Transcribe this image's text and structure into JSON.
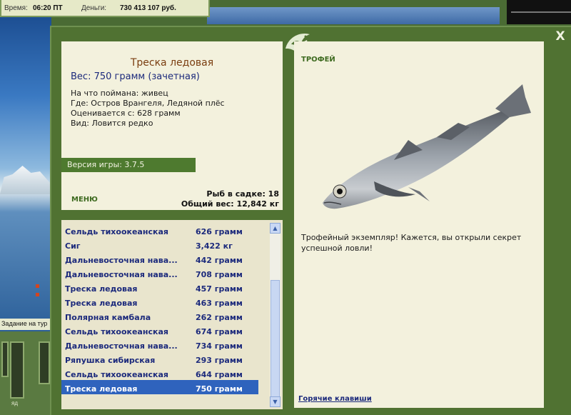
{
  "status_bar": {
    "time_label": "Время:",
    "time_value": "06:20 ПТ",
    "money_label": "Деньги:",
    "money_value": "730 413 107 руб."
  },
  "background": {
    "task_label": "Задание на тур",
    "bottom_label": "яд"
  },
  "dialog": {
    "close_symbol": "X",
    "info": {
      "fish_name": "Треска ледовая",
      "weight_line": "Вес: 750 грамм (зачетная)",
      "bait_line": "На что поймана: живец",
      "location_line": "Где: Остров Врангеля, Ледяной плёс",
      "rating_line": "Оценивается с: 628 грамм",
      "rarity_line": "Вид: Ловится редко"
    },
    "version": "Версия игры: 3.7.5",
    "menu_label": "МЕНЮ",
    "keep_count": "Рыб в садке: 18",
    "keep_weight": "Общий вес: 12,842 кг",
    "catch_list": [
      {
        "name": "Сельдь тихоокеанская",
        "weight": "626 грамм"
      },
      {
        "name": "Сиг",
        "weight": "3,422 кг"
      },
      {
        "name": "Дальневосточная нава...",
        "weight": "442 грамм"
      },
      {
        "name": "Дальневосточная нава...",
        "weight": "708 грамм"
      },
      {
        "name": "Треска ледовая",
        "weight": "457 грамм"
      },
      {
        "name": "Треска ледовая",
        "weight": "463 грамм"
      },
      {
        "name": "Полярная камбала",
        "weight": "262 грамм"
      },
      {
        "name": "Сельдь тихоокеанская",
        "weight": "674 грамм"
      },
      {
        "name": "Дальневосточная нава...",
        "weight": "734 грамм"
      },
      {
        "name": "Ряпушка сибирская",
        "weight": "293 грамм"
      },
      {
        "name": "Сельдь тихоокеанская",
        "weight": "644 грамм"
      },
      {
        "name": "Треска ледовая",
        "weight": "750 грамм"
      }
    ],
    "selected_index": 11,
    "trophy": {
      "title": "ТРОФЕЙ",
      "message": "Трофейный экземпляр! Кажется, вы открыли секрет успешной ловли!",
      "hotkeys_label": "Горячие клавиши"
    }
  },
  "icons": {
    "close": "close-icon",
    "logo": "leaping-fish-logo-icon",
    "scroll_up": "scroll-up-arrow-icon",
    "scroll_down": "scroll-down-arrow-icon"
  },
  "colors": {
    "dialog_green": "#507232",
    "panel_beige": "#f3f1dd",
    "list_text_blue": "#1c2a7c",
    "selection_blue": "#2f63bd",
    "fish_name_brown": "#7a3d10"
  }
}
